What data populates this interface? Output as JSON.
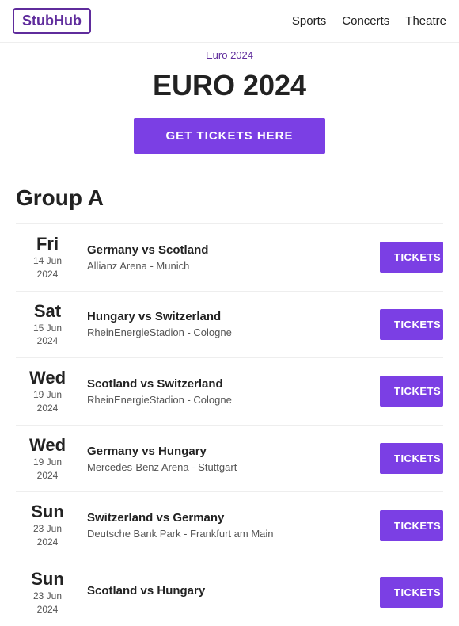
{
  "header": {
    "logo": "StubHub",
    "nav": [
      {
        "label": "Sports",
        "id": "sports"
      },
      {
        "label": "Concerts",
        "id": "concerts"
      },
      {
        "label": "Theatre",
        "id": "theatre"
      }
    ]
  },
  "breadcrumb": "Euro 2024",
  "hero": {
    "title": "EURO 2024",
    "cta_label": "GET TICKETS HERE"
  },
  "group": {
    "title": "Group A",
    "events": [
      {
        "day": "Fri",
        "date_line1": "14 Jun",
        "date_line2": "2024",
        "name": "Germany vs Scotland",
        "venue": "Allianz Arena - Munich",
        "tickets_label": "TICKETS"
      },
      {
        "day": "Sat",
        "date_line1": "15 Jun",
        "date_line2": "2024",
        "name": "Hungary vs Switzerland",
        "venue": "RheinEnergieStadion - Cologne",
        "tickets_label": "TICKETS"
      },
      {
        "day": "Wed",
        "date_line1": "19 Jun",
        "date_line2": "2024",
        "name": "Scotland vs Switzerland",
        "venue": "RheinEnergieStadion - Cologne",
        "tickets_label": "TICKETS"
      },
      {
        "day": "Wed",
        "date_line1": "19 Jun",
        "date_line2": "2024",
        "name": "Germany vs Hungary",
        "venue": "Mercedes-Benz Arena - Stuttgart",
        "tickets_label": "TICKETS"
      },
      {
        "day": "Sun",
        "date_line1": "23 Jun",
        "date_line2": "2024",
        "name": "Switzerland vs Germany",
        "venue": "Deutsche Bank Park - Frankfurt am Main",
        "tickets_label": "TICKETS"
      },
      {
        "day": "Sun",
        "date_line1": "23 Jun",
        "date_line2": "2024",
        "name": "Scotland vs Hungary",
        "venue": "",
        "tickets_label": "TICKETS"
      }
    ]
  }
}
